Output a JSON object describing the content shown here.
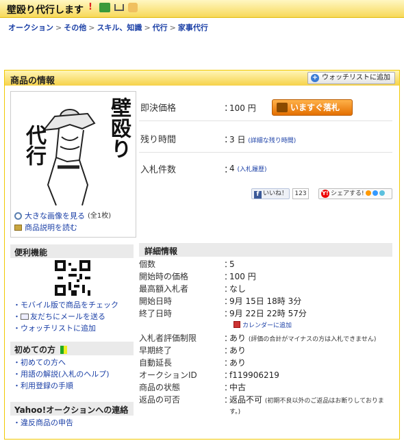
{
  "header": {
    "title": "壁殴り代行します",
    "icons": [
      "exclamation-icon",
      "truck-icon",
      "cart-icon",
      "hand-icon"
    ]
  },
  "breadcrumb": [
    "オークション",
    "その他",
    "スキル、知識",
    "代行",
    "家事代行"
  ],
  "panel": {
    "title": "商品の情報",
    "watch_button": "ウォッチリストに追加"
  },
  "image_links": {
    "large_image": "大きな画像を見る",
    "large_image_count": "(全1枚)",
    "description": "商品説明を読む"
  },
  "image_art": {
    "text_top": "壁殴り",
    "text_left": "代行"
  },
  "price": {
    "buyout_label": "即決価格",
    "buyout_value": "100 円",
    "buy_button": "いますぐ落札",
    "time_label": "残り時間",
    "time_value": "3 日",
    "time_link": "(詳細な残り時間)",
    "bids_label": "入札件数",
    "bids_value": "4",
    "bids_link": "(入札履歴)"
  },
  "social": {
    "like_label": "いいね！",
    "like_count": "123",
    "share_label": "シェアする!"
  },
  "convenience": {
    "title": "便利機能",
    "items": [
      "モバイル版で商品をチェック",
      "友だちにメールを送る",
      "ウォッチリストに追加"
    ]
  },
  "beginner": {
    "title": "初めての方",
    "items": [
      "初めての方へ",
      "用語の解説(入札のヘルプ)",
      "利用登録の手順"
    ]
  },
  "contact": {
    "title": "Yahoo!オークションへの連絡",
    "items": [
      "違反商品の申告"
    ]
  },
  "details": {
    "title": "詳細情報",
    "rows": [
      {
        "label": "個数",
        "value": "5"
      },
      {
        "label": "開始時の価格",
        "value": "100 円"
      },
      {
        "label": "最高額入札者",
        "value": "なし"
      },
      {
        "label": "開始日時",
        "value": "9月 15日 18時 3分"
      },
      {
        "label": "終了日時",
        "value": "9月 22日 22時 57分"
      },
      {
        "label": "入札者評価制限",
        "value": "あり",
        "note": "(評価の合計がマイナスの方は入札できません)"
      },
      {
        "label": "早期終了",
        "value": "あり"
      },
      {
        "label": "自動延長",
        "value": "あり"
      },
      {
        "label": "オークションID",
        "value": "f119906219"
      },
      {
        "label": "商品の状態",
        "value": "中古"
      },
      {
        "label": "返品の可否",
        "value": "返品不可",
        "note": "(初期不良以外のご返品はお断りしておりま",
        "note2": "す。)"
      }
    ],
    "calendar_link": "カレンダーに追加"
  },
  "colors": {
    "accent_yellow": "#f6d24a",
    "link_blue": "#1a3fa6",
    "buy_orange": "#e46f00"
  }
}
